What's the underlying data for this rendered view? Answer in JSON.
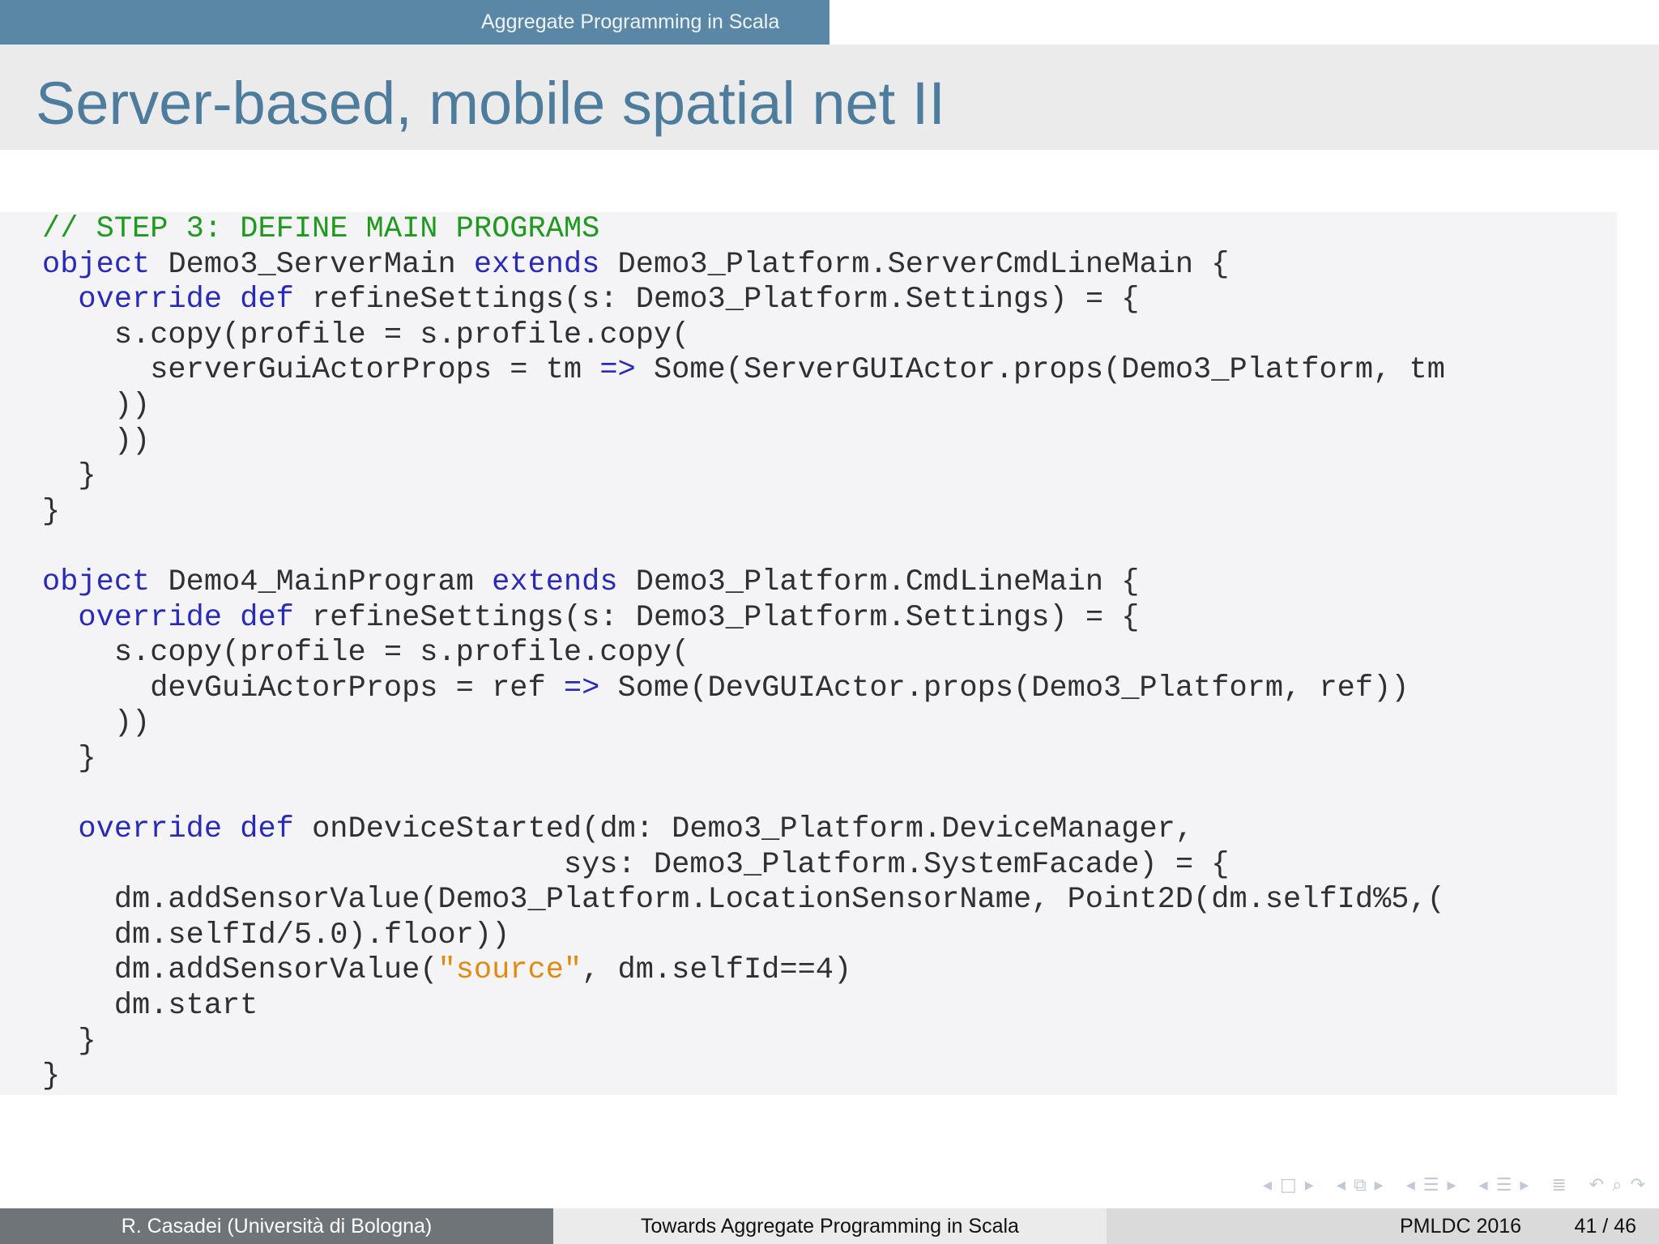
{
  "header": {
    "section_title": "Aggregate Programming in Scala",
    "frame_title": "Server-based, mobile spatial net II"
  },
  "code": {
    "language": "scala",
    "lines": [
      [
        {
          "t": "cm",
          "v": "// STEP 3: DEFINE MAIN PROGRAMS"
        }
      ],
      [
        {
          "t": "kw",
          "v": "object"
        },
        {
          "t": "tx",
          "v": " Demo3_ServerMain "
        },
        {
          "t": "kw",
          "v": "extends"
        },
        {
          "t": "tx",
          "v": " Demo3_Platform.ServerCmdLineMain {"
        }
      ],
      [
        {
          "t": "tx",
          "v": "  "
        },
        {
          "t": "kw",
          "v": "override def"
        },
        {
          "t": "tx",
          "v": " refineSettings(s: Demo3_Platform.Settings) = {"
        }
      ],
      [
        {
          "t": "tx",
          "v": "    s.copy(profile = s.profile.copy("
        }
      ],
      [
        {
          "t": "tx",
          "v": "      serverGuiActorProps = tm "
        },
        {
          "t": "kw",
          "v": "=>"
        },
        {
          "t": "tx",
          "v": " Some(ServerGUIActor.props(Demo3_Platform, tm"
        }
      ],
      [
        {
          "t": "tx",
          "v": "    ))"
        }
      ],
      [
        {
          "t": "tx",
          "v": "    ))"
        }
      ],
      [
        {
          "t": "tx",
          "v": "  }"
        }
      ],
      [
        {
          "t": "tx",
          "v": "}"
        }
      ],
      [
        {
          "t": "tx",
          "v": ""
        }
      ],
      [
        {
          "t": "kw",
          "v": "object"
        },
        {
          "t": "tx",
          "v": " Demo4_MainProgram "
        },
        {
          "t": "kw",
          "v": "extends"
        },
        {
          "t": "tx",
          "v": " Demo3_Platform.CmdLineMain {"
        }
      ],
      [
        {
          "t": "tx",
          "v": "  "
        },
        {
          "t": "kw",
          "v": "override def"
        },
        {
          "t": "tx",
          "v": " refineSettings(s: Demo3_Platform.Settings) = {"
        }
      ],
      [
        {
          "t": "tx",
          "v": "    s.copy(profile = s.profile.copy("
        }
      ],
      [
        {
          "t": "tx",
          "v": "      devGuiActorProps = ref "
        },
        {
          "t": "kw",
          "v": "=>"
        },
        {
          "t": "tx",
          "v": " Some(DevGUIActor.props(Demo3_Platform, ref))"
        }
      ],
      [
        {
          "t": "tx",
          "v": "    ))"
        }
      ],
      [
        {
          "t": "tx",
          "v": "  }"
        }
      ],
      [
        {
          "t": "tx",
          "v": ""
        }
      ],
      [
        {
          "t": "tx",
          "v": "  "
        },
        {
          "t": "kw",
          "v": "override def"
        },
        {
          "t": "tx",
          "v": " onDeviceStarted(dm: Demo3_Platform.DeviceManager,"
        }
      ],
      [
        {
          "t": "tx",
          "v": "                             sys: Demo3_Platform.SystemFacade) = {"
        }
      ],
      [
        {
          "t": "tx",
          "v": "    dm.addSensorValue(Demo3_Platform.LocationSensorName, Point2D(dm.selfId%5,("
        }
      ],
      [
        {
          "t": "tx",
          "v": "    dm.selfId/5.0).floor))"
        }
      ],
      [
        {
          "t": "tx",
          "v": "    dm.addSensorValue("
        },
        {
          "t": "st",
          "v": "\"source\""
        },
        {
          "t": "tx",
          "v": ", dm.selfId==4)"
        }
      ],
      [
        {
          "t": "tx",
          "v": "    dm.start"
        }
      ],
      [
        {
          "t": "tx",
          "v": "  }"
        }
      ],
      [
        {
          "t": "tx",
          "v": "}"
        }
      ]
    ]
  },
  "colors": {
    "header_bar": "#5b87a6",
    "title_text": "#4d7c9d",
    "code_background": "#f4f4f6",
    "keyword": "#2a2ab8",
    "comment": "#1f9a1f",
    "string": "#e08a10",
    "footer_left": "#6f7479"
  },
  "navigation": {
    "icons": [
      "nav-prev-slide-icon",
      "nav-slide-icon",
      "nav-next-slide-icon",
      "nav-prev-frame-icon",
      "nav-frame-icon",
      "nav-next-frame-icon",
      "nav-prev-subsection-icon",
      "nav-subsection-icon",
      "nav-next-subsection-icon",
      "nav-prev-section-icon",
      "nav-section-icon",
      "nav-next-section-icon",
      "nav-toc-icon",
      "nav-back-icon",
      "nav-search-icon",
      "nav-forward-icon"
    ]
  },
  "footer": {
    "author": "R. Casadei  (Università di Bologna)",
    "talk_title": "Towards Aggregate Programming in Scala",
    "conference": "PMLDC 2016",
    "page": "41 / 46"
  }
}
